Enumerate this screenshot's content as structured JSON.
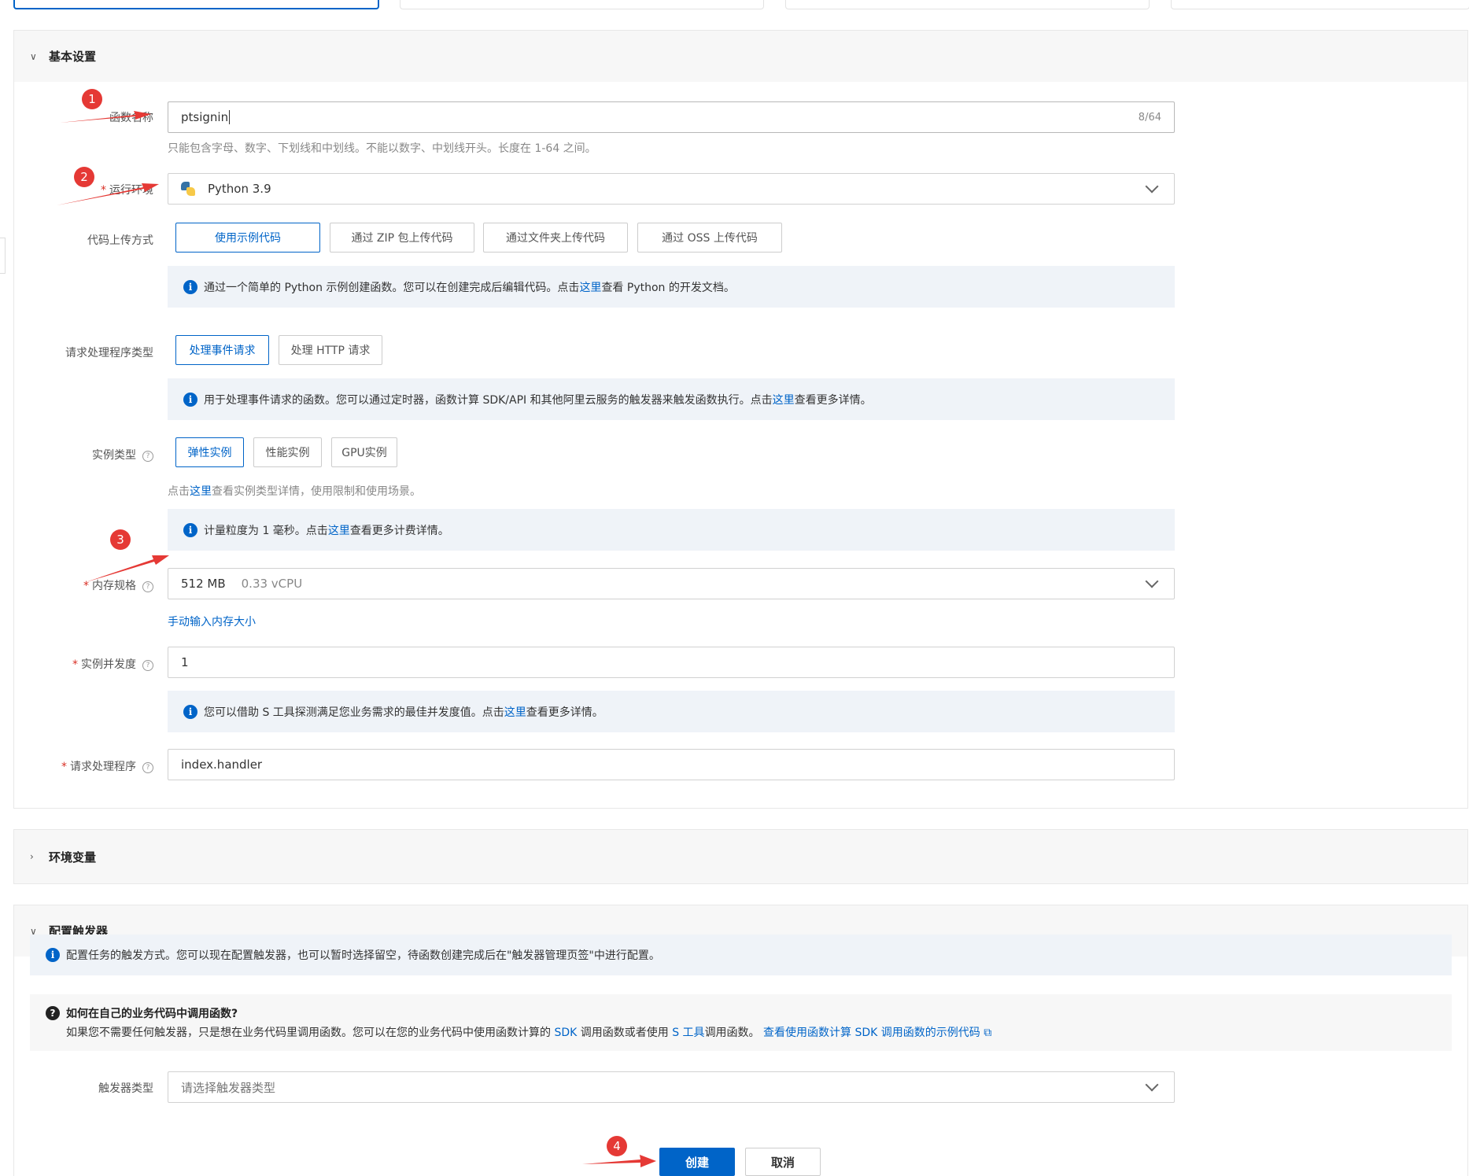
{
  "basic_settings": {
    "title": "基本设置",
    "function_name": {
      "label": "函数名称",
      "value": "ptsignin",
      "counter": "8/64",
      "hint": "只能包含字母、数字、下划线和中划线。不能以数字、中划线开头。长度在 1-64 之间。"
    },
    "runtime": {
      "label": "运行环境",
      "value": "Python 3.9",
      "icon": "python-icon"
    },
    "upload": {
      "label": "代码上传方式",
      "options": [
        "使用示例代码",
        "通过 ZIP 包上传代码",
        "通过文件夹上传代码",
        "通过 OSS 上传代码"
      ],
      "info_prefix": "通过一个简单的 Python 示例创建函数。您可以在创建完成后编辑代码。点击",
      "info_link": "这里",
      "info_suffix": "查看 Python 的开发文档。"
    },
    "handler_type": {
      "label": "请求处理程序类型",
      "options": [
        "处理事件请求",
        "处理 HTTP 请求"
      ],
      "info_prefix": "用于处理事件请求的函数。您可以通过定时器，函数计算 SDK/API 和其他阿里云服务的触发器来触发函数执行。点击",
      "info_link": "这里",
      "info_suffix": "查看更多详情。"
    },
    "instance_type": {
      "label": "实例类型",
      "options": [
        "弹性实例",
        "性能实例",
        "GPU实例"
      ],
      "hint_prefix": "点击",
      "hint_link": "这里",
      "hint_suffix": "查看实例类型详情，使用限制和使用场景。",
      "info_prefix": "计量粒度为 1 毫秒。点击",
      "info_link": "这里",
      "info_suffix": "查看更多计费详情。"
    },
    "memory": {
      "label": "内存规格",
      "value": "512 MB",
      "vcpu": "0.33 vCPU",
      "manual_link": "手动输入内存大小"
    },
    "concurrency": {
      "label": "实例并发度",
      "value": "1",
      "info_prefix": "您可以借助 S 工具探测满足您业务需求的最佳并发度值。点击",
      "info_link": "这里",
      "info_suffix": "查看更多详情。"
    },
    "handler": {
      "label": "请求处理程序",
      "value": "index.handler"
    }
  },
  "env_section": {
    "title": "环境变量"
  },
  "trigger_section": {
    "title": "配置触发器",
    "info": "配置任务的触发方式。您可以现在配置触发器，也可以暂时选择留空，待函数创建完成后在\"触发器管理页签\"中进行配置。",
    "faq_title": "如何在自己的业务代码中调用函数?",
    "faq_prefix": "如果您不需要任何触发器，只是想在业务代码里调用函数。您可以在您的业务代码中使用函数计算的",
    "faq_sdk": "SDK",
    "faq_mid": "调用函数或者使用",
    "faq_stool": "S 工具",
    "faq_mid2": "调用函数。",
    "faq_link": "查看使用函数计算 SDK 调用函数的示例代码",
    "trigger_type": {
      "label": "触发器类型",
      "placeholder": "请选择触发器类型"
    }
  },
  "footer": {
    "create": "创建",
    "cancel": "取消"
  },
  "annotations": [
    "1",
    "2",
    "3",
    "4"
  ],
  "colors": {
    "primary": "#0064c8",
    "annotation": "#e53935",
    "info_bg": "#eff3f8"
  }
}
